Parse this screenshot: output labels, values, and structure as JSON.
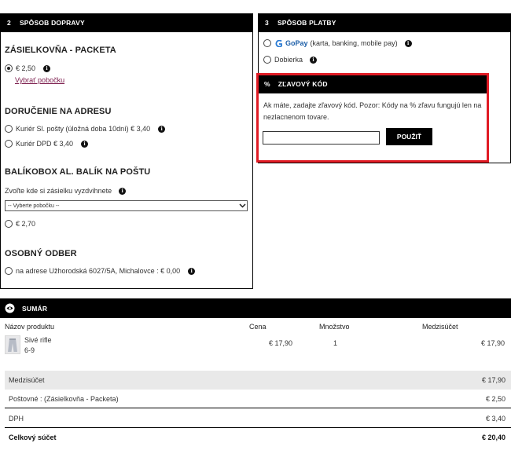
{
  "shipping": {
    "num": "2",
    "title": "SPÔSOB DOPRAVY",
    "packeta": {
      "heading": "ZÁSIELKOVŇA - PACKETA",
      "price": "€ 2,50",
      "link": "Vybrať pobočku"
    },
    "address": {
      "heading": "DORUČENIE NA ADRESU",
      "option1": "Kuriér Sl. pošty (úložná doba 10dní) € 3,40",
      "option2": "Kuriér DPD € 3,40"
    },
    "balikobox": {
      "heading": "BALÍKOBOX AL. BALÍK NA POŠTU",
      "hint": "Zvoľte kde si zásielku vyzdvihnete",
      "select_value": "-- Vyberte pobočku --",
      "price": "€ 2,70"
    },
    "pickup": {
      "heading": "OSOBNÝ ODBER",
      "option": "na adrese Užhorodská 6027/5A, Michalovce : € 0,00"
    }
  },
  "payment": {
    "num": "3",
    "title": "SPÔSOB PLATBY",
    "gopay_brand": "GoPay",
    "gopay_desc": "(karta, banking, mobile pay)",
    "cod": "Dobierka"
  },
  "discount": {
    "num": "%",
    "title": "ZĽAVOVÝ KÓD",
    "text": "Ak máte, zadajte zľavový kód. Pozor: Kódy na % zľavu fungujú len na nezlacnenom tovare.",
    "input_value": "",
    "button": "POUŽIŤ"
  },
  "summary": {
    "title": "SUMÁR",
    "columns": {
      "product": "Názov produktu",
      "price": "Cena",
      "qty": "Množstvo",
      "subtotal": "Medzisúčet"
    },
    "item": {
      "name": "Sivé rifle",
      "variant": "6-9",
      "price": "€ 17,90",
      "qty": "1",
      "subtotal": "€ 17,90"
    },
    "rows": {
      "subtotal_label": "Medzisúčet",
      "subtotal_value": "€ 17,90",
      "shipping_label": "Poštovné : (Zásielkovňa - Packeta)",
      "shipping_value": "€ 2,50",
      "vat_label": "DPH",
      "vat_value": "€ 3,40",
      "total_label": "Celkový súčet",
      "total_value": "€ 20,40"
    }
  },
  "colors": {
    "accent": "#e01b24",
    "bar": "#000000",
    "link": "#7a1a4a",
    "gopay": "#2a7bd4"
  }
}
